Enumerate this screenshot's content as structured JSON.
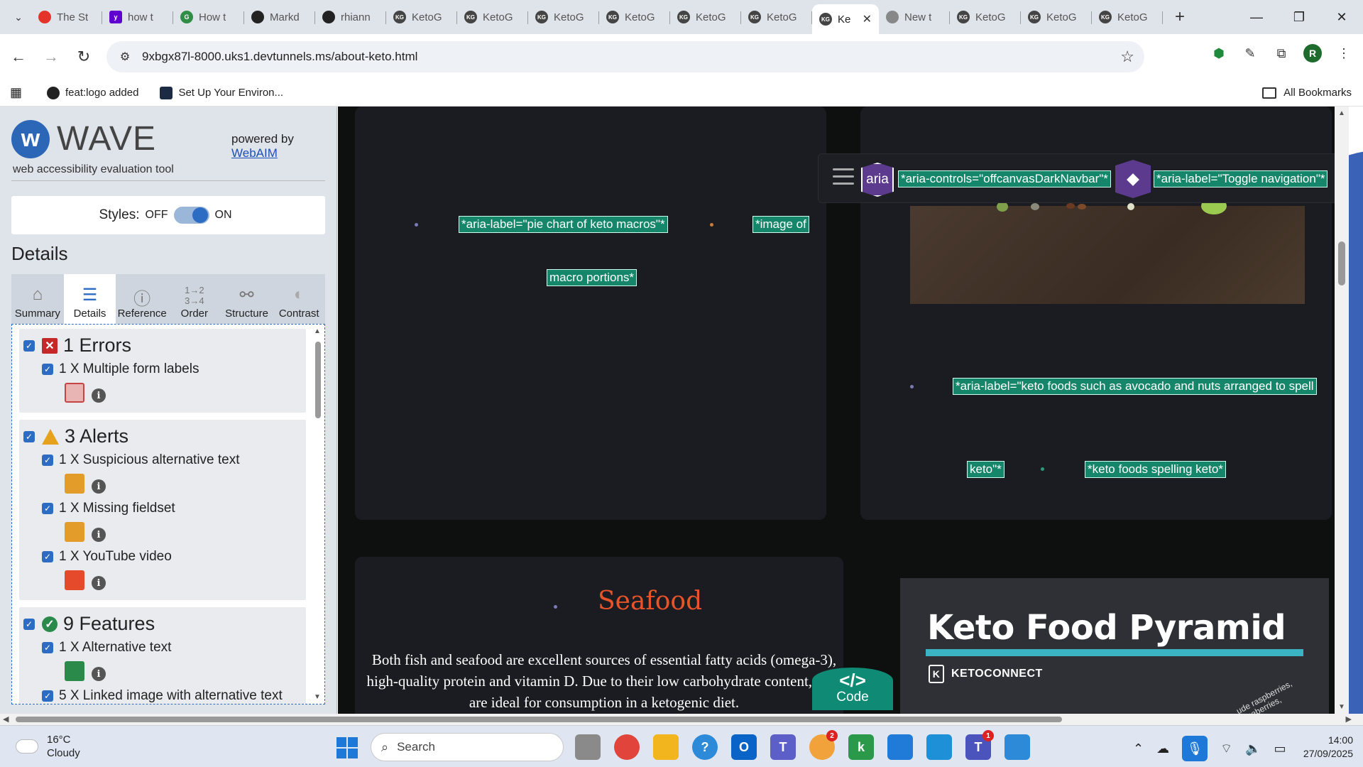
{
  "browser": {
    "tabs": [
      {
        "title": "The St",
        "icon": "opera-icon"
      },
      {
        "title": "how t",
        "icon": "yahoo-icon"
      },
      {
        "title": "How t",
        "icon": "geeks-icon"
      },
      {
        "title": "Markd",
        "icon": "github-icon"
      },
      {
        "title": "rhiann",
        "icon": "github-icon"
      },
      {
        "title": "KetoG",
        "icon": "kg-icon"
      },
      {
        "title": "KetoG",
        "icon": "kg-icon"
      },
      {
        "title": "KetoG",
        "icon": "kg-icon"
      },
      {
        "title": "KetoG",
        "icon": "kg-icon"
      },
      {
        "title": "KetoG",
        "icon": "kg-icon"
      },
      {
        "title": "KetoG",
        "icon": "kg-icon"
      },
      {
        "title": "Ke",
        "icon": "kg-icon",
        "active": true
      },
      {
        "title": "New t",
        "icon": "chrome-icon"
      },
      {
        "title": "KetoG",
        "icon": "kg-icon"
      },
      {
        "title": "KetoG",
        "icon": "kg-icon"
      },
      {
        "title": "KetoG",
        "icon": "kg-icon"
      }
    ],
    "url": "9xbgx87l-8000.uks1.devtunnels.ms/about-keto.html",
    "bookmarks": {
      "item1": "feat:logo added",
      "item2": "Set Up Your Environ...",
      "all": "All Bookmarks"
    },
    "profile_initial": "R"
  },
  "wave": {
    "brand": "WAVE",
    "tagline": "web accessibility evaluation tool",
    "powered_by": "powered by",
    "webaim": "WebAIM",
    "styles_label": "Styles:",
    "styles_off": "OFF",
    "styles_on": "ON",
    "details_heading": "Details",
    "tabs": [
      "Summary",
      "Details",
      "Reference",
      "Order",
      "Structure",
      "Contrast"
    ],
    "groups": {
      "errors": {
        "title": "1 Errors",
        "items": [
          "1 X Multiple form labels"
        ]
      },
      "alerts": {
        "title": "3 Alerts",
        "items": [
          "1 X Suspicious alternative text",
          "1 X Missing fieldset",
          "1 X YouTube video"
        ]
      },
      "features": {
        "title": "9 Features",
        "items": [
          "1 X Alternative text",
          "5 X Linked image with alternative text"
        ]
      }
    }
  },
  "page": {
    "aria_tags": {
      "pie": "*aria-label=\"pie chart of keto macros\"*",
      "image_of": "*image of",
      "macro_portions": "macro portions*",
      "controls": "*aria-controls=\"offcanvasDarkNavbar\"*",
      "toggle": "*aria-label=\"Toggle navigation\"*",
      "keto_foods_1": "*aria-label=\"keto foods such as avocado and nuts arranged to spell",
      "keto_foods_2": "keto\"*",
      "keto_spelling": "*keto foods spelling keto*"
    },
    "aria_badge": "aria",
    "seafood_title": "Seafood",
    "seafood_text": "Both fish and seafood are excellent sources of essential fatty acids (omega-3), high-quality protein and vitamin D. Due to their low carbohydrate content, they are ideal for consumption in a ketogenic diet.",
    "pyramid_title": "Keto Food Pyramid",
    "pyramid_brand": "KETOCONNECT",
    "pyramid_berries": "ude raspberries, blueberries,",
    "code_label": "Code",
    "code_glyph": "</>",
    "accent_color": "#16866a"
  },
  "taskbar": {
    "temp": "16°C",
    "weather": "Cloudy",
    "search": "Search",
    "time": "14:00",
    "date": "27/09/2025",
    "badges": {
      "copilot": "2",
      "teams": "1"
    }
  }
}
